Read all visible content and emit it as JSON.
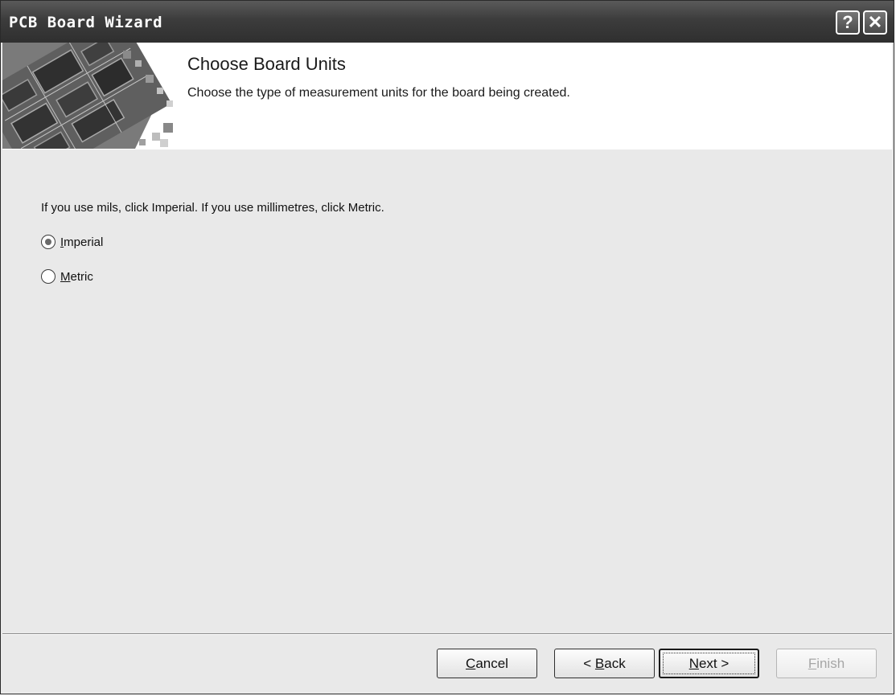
{
  "window": {
    "title": "PCB Board Wizard",
    "help_glyph": "?",
    "close_glyph": "✕"
  },
  "header": {
    "title": "Choose Board Units",
    "subtitle": "Choose the type of measurement units for the board being created."
  },
  "body": {
    "prompt": "If you use mils, click Imperial. If you use millimetres, click Metric.",
    "units": {
      "selected": "Imperial",
      "options": [
        {
          "mnemonic": "I",
          "rest": "mperial",
          "checked": true
        },
        {
          "mnemonic": "M",
          "rest": "etric",
          "checked": false
        }
      ]
    }
  },
  "buttons": {
    "cancel": {
      "mnemonic": "C",
      "rest": "ancel"
    },
    "back": {
      "prefix": "< ",
      "mnemonic": "B",
      "rest": "ack"
    },
    "next": {
      "mnemonic": "N",
      "rest": "ext >",
      "default": true
    },
    "finish": {
      "mnemonic": "F",
      "rest": "inish",
      "enabled": false
    }
  },
  "colors": {
    "titlebar": "#3c3c3c",
    "dialog_bg": "#e9e9e9",
    "header_bg": "#ffffff",
    "disabled_text": "#a6a6a6"
  },
  "icons": {
    "banner": "pcb-circuit-board-image",
    "help": "help-icon",
    "close": "close-icon"
  }
}
